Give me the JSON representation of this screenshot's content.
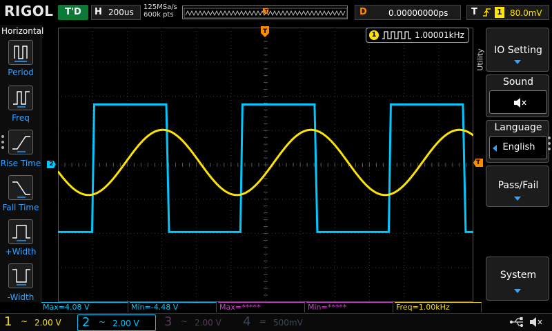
{
  "brand": "RIGOL",
  "top": {
    "trigger_status": "T'D",
    "horizontal": {
      "key": "H",
      "value": "200us"
    },
    "sample_rate": "125MSa/s",
    "memory_depth": "600k pts",
    "delay": {
      "key": "D",
      "value": "0.00000000ps"
    },
    "trigger": {
      "key": "T",
      "edge_icon": "rising-edge-icon",
      "source": "1",
      "level": "80.0mV"
    }
  },
  "left_menu": {
    "title": "Horizontal",
    "items": [
      {
        "label": "Period",
        "icon": "period-icon"
      },
      {
        "label": "Freq",
        "icon": "frequency-icon"
      },
      {
        "label": "Rise Time",
        "icon": "rise-time-icon"
      },
      {
        "label": "Fall Time",
        "icon": "fall-time-icon"
      },
      {
        "label": "+Width",
        "icon": "positive-width-icon"
      },
      {
        "label": "-Width",
        "icon": "negative-width-icon"
      }
    ]
  },
  "grid": {
    "ch2_marker": "2",
    "trigger_level_marker": "T",
    "frequency_counter": {
      "channel": "1",
      "value": "1.00001kHz"
    }
  },
  "right_menu": {
    "tab": "Utility",
    "items": [
      {
        "label": "IO Setting"
      },
      {
        "label": "Sound",
        "value_icon": "speaker-muted-icon"
      },
      {
        "label": "Language",
        "value": "English"
      },
      {
        "label": "Pass/Fail"
      },
      {
        "label": "System"
      }
    ]
  },
  "measurements": [
    {
      "text": "Max=4.08 V",
      "color": "#00c8ff"
    },
    {
      "text": "Min=-4.48 V",
      "color": "#00c8ff"
    },
    {
      "text": "Max=*****",
      "color": "#d040d0"
    },
    {
      "text": "Min=*****",
      "color": "#d040d0"
    },
    {
      "text": "Freq=1.00kHz",
      "color": "#ffe400"
    }
  ],
  "channels": [
    {
      "num": "1",
      "coupling_icon": "ac-coupling-icon",
      "coupling": "~",
      "scale": "2.00 V",
      "color": "#ffe400",
      "active": true
    },
    {
      "num": "2",
      "coupling_icon": "ac-coupling-icon",
      "coupling": "~",
      "scale": "2.00 V",
      "color": "#00c8ff",
      "active": true
    },
    {
      "num": "3",
      "coupling_icon": "ac-coupling-icon",
      "coupling": "~",
      "scale": "2.00 V",
      "color": "#5a3a5a",
      "active": false
    },
    {
      "num": "4",
      "coupling_icon": "dc-coupling-icon",
      "coupling": "=",
      "scale": "500mV",
      "color": "#3a4a5a",
      "active": false
    }
  ],
  "colors": {
    "ch1": "#ffe400",
    "ch2": "#00c8ff",
    "trigger": "#ff8a00",
    "accent": "#34a3ff",
    "grid": "#3a3a3a"
  },
  "chart_data": {
    "type": "line",
    "x_unit": "us",
    "x_range": [
      -1400,
      1400
    ],
    "series": [
      {
        "channel": "1",
        "shape": "sine",
        "frequency_hz": 1000,
        "amplitude_divisions": 0.95,
        "offset_divisions": 0.15
      },
      {
        "channel": "2",
        "shape": "square",
        "frequency_hz": 1000,
        "high_v": 4.08,
        "low_v": -4.48
      }
    ]
  }
}
